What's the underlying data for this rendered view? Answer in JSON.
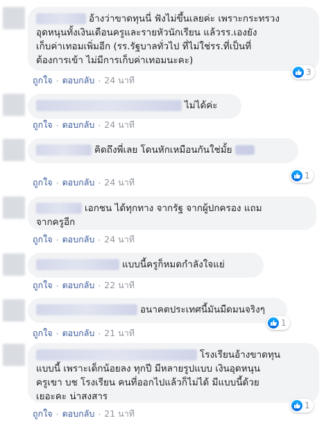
{
  "actions": {
    "like": "ถูกใจ",
    "reply": "ตอบกลับ",
    "separator": "·"
  },
  "comments": [
    {
      "text": "อ้างว่าขาดทุนนี่ ฟังไม่ขึ้นเลยค่ะ เพราะกระทรวง\nอุดหนุนทั้งเงินเดือนครูและรายหัวนักเรียน แล้วรร.เองยัง\nเก็บค่าเทอมเพิ่มอีก (รร.รัฐบาลทั่วไป ที่ไม่ใช่รร.ที่เป็นที่\nต้องการเข้า ไม่มีการเก็บค่าเทอมนะคะ)",
      "time": "24 นาที",
      "reactions": "3"
    },
    {
      "text": "ไม่ได้ค่ะ",
      "time": "24 นาที",
      "reactions": ""
    },
    {
      "text": "คิดถึงพี่เลย โดนหักเหมือนกันใช่มั้ย",
      "time": "24 นาที",
      "reactions": "1"
    },
    {
      "text": "เอกชน ได้ทุกทาง จากรัฐ จากผู้ปกครอง แถม\nจากครูอีก",
      "time": "24 นาที",
      "reactions": ""
    },
    {
      "text": "แบบนี้ครูก็หมดกำลังใจแย่",
      "time": "22 นาที",
      "reactions": ""
    },
    {
      "text": "อนาคตประเทศนี้มันมืดมนจริงๆ",
      "time": "21 นาที",
      "reactions": "1"
    },
    {
      "text": "โรงเรียนอ้างขาดทุน\nแบบนี้ เพราะเด็กน้อยลง ทุกปี มีหลายรูปแบบ เงินอุดหนุน\nครูเขา บช โรงเรียน คนที่ออกไปแล้วก็ไม่ได้ มีแบบนี้ด้วย\nเยอะคะ น่าสงสาร",
      "time": "21 นาที",
      "reactions": "1"
    }
  ],
  "colors": {
    "bubble": "#f2f3f5",
    "link": "#385898",
    "meta": "#90949c",
    "like_blue": "#1877f2"
  },
  "icons": {
    "like": "thumbs-up-icon"
  }
}
